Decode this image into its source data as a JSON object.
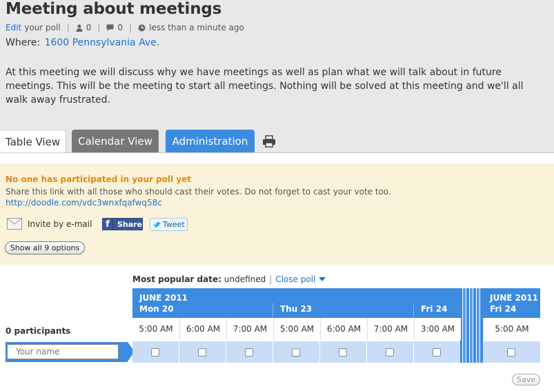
{
  "poll": {
    "title": "Meeting about meetings",
    "edit_label": "Edit",
    "edit_suffix": "your poll",
    "participants_count": "0",
    "comments_count": "0",
    "time_ago": "less than a minute ago",
    "where_label": "Where:",
    "where_value": "1600 Pennsylvania Ave.",
    "description": "At this meeting we will discuss why we have meetings as well as plan what we will talk about in future meetings. This will be the meeting to start all meetings. Nothing will be solved at this meeting and we'll all walk away frustrated."
  },
  "tabs": {
    "table": "Table View",
    "calendar": "Calendar View",
    "admin": "Administration"
  },
  "notice": {
    "title": "No one has participated in your poll yet",
    "text": "Share this link with all those who should cast their votes. Do not forget to cast your vote too.",
    "link": "http://doodle.com/vdc3wnxfqafwq58c",
    "invite": "Invite by e-mail",
    "share": "Share",
    "tweet": "Tweet",
    "show_all": "Show all 9 options"
  },
  "grid": {
    "popular_label": "Most popular date:",
    "popular_value": "undefined",
    "close_poll": "Close poll",
    "month1": "JUNE 2011",
    "day_mon": "Mon 20",
    "day_thu": "Thu 23",
    "day_fri": "Fri 24",
    "month2": "JUNE 2011",
    "day_fri2": "Fri 24",
    "participants": "0 participants",
    "times": [
      "5:00 AM",
      "6:00 AM",
      "7:00 AM",
      "5:00 AM",
      "6:00 AM",
      "7:00 AM",
      "3:00 AM"
    ],
    "time_last": "5:00 AM",
    "name_placeholder": "Your name",
    "save": "Save"
  }
}
